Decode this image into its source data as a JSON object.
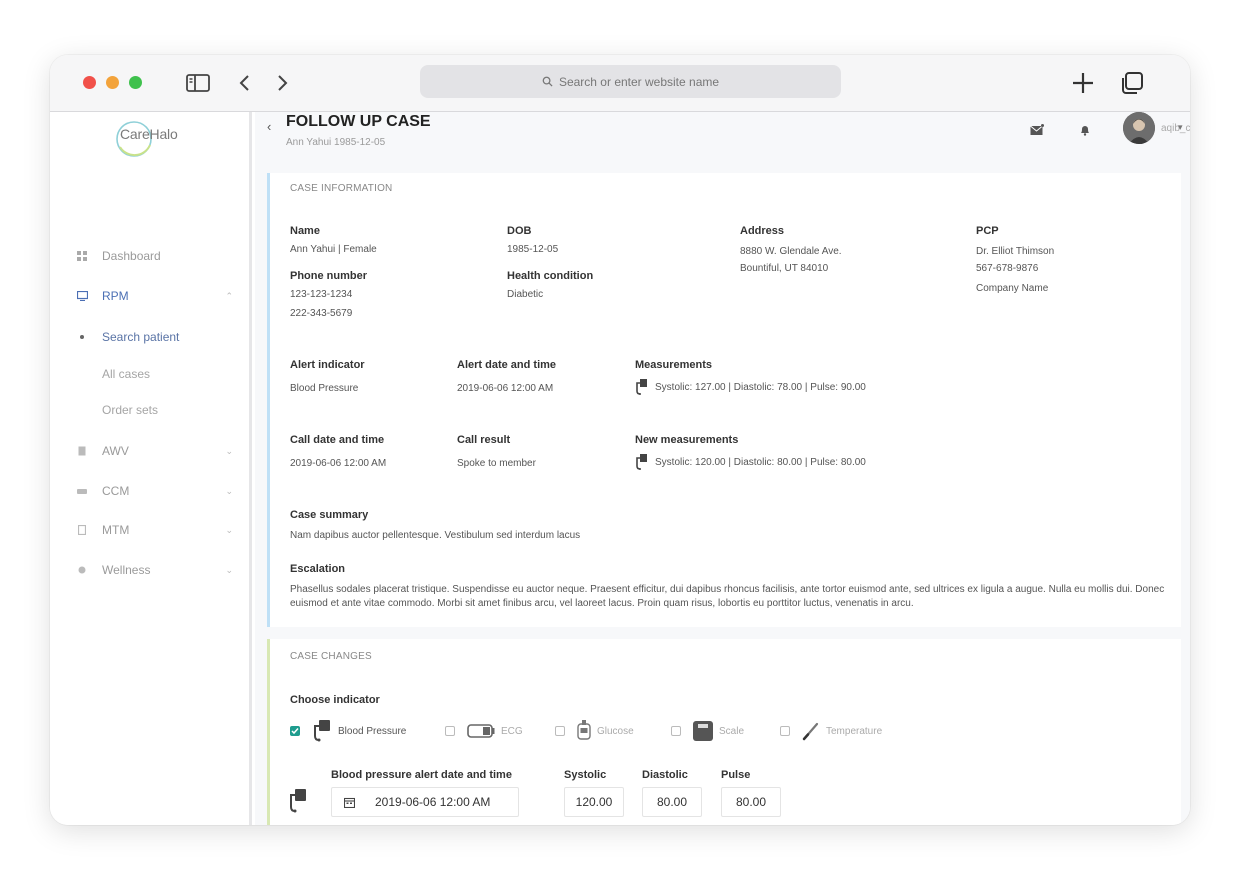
{
  "browser": {
    "url_placeholder": "Search or enter website name"
  },
  "sidebar": {
    "logo": "CareHalo",
    "items": [
      {
        "label": "Dashboard"
      },
      {
        "label": "RPM"
      },
      {
        "label": "AWV"
      },
      {
        "label": "CCM"
      },
      {
        "label": "MTM"
      },
      {
        "label": "Wellness"
      }
    ],
    "rpm_sub": [
      {
        "label": "Search patient"
      },
      {
        "label": "All cases"
      },
      {
        "label": "Order sets"
      }
    ]
  },
  "header": {
    "title": "FOLLOW UP CASE",
    "subtitle": "Ann Yahui  1985-12-05",
    "username": "aqib_care"
  },
  "case_info": {
    "title": "CASE INFORMATION",
    "name_label": "Name",
    "name_value": "Ann Yahui | Female",
    "dob_label": "DOB",
    "dob_value": "1985-12-05",
    "address_label": "Address",
    "address_line1": "8880 W. Glendale Ave.",
    "address_line2": "Bountiful, UT 84010",
    "pcp_label": "PCP",
    "pcp_name": "Dr. Elliot Thimson",
    "pcp_phone": "567-678-9876",
    "pcp_company": "Company Name",
    "phone_label": "Phone number",
    "phone1": "123-123-1234",
    "phone2": "222-343-5679",
    "health_label": "Health condition",
    "health_value": "Diabetic",
    "alert_indicator_label": "Alert indicator",
    "alert_indicator_value": "Blood Pressure",
    "alert_dt_label": "Alert date and time",
    "alert_dt_value": "2019-06-06 12:00 AM",
    "measurements_label": "Measurements",
    "measurements_value": "Systolic: 127.00  |  Diastolic: 78.00  |  Pulse: 90.00",
    "call_dt_label": "Call date and time",
    "call_dt_value": "2019-06-06 12:00 AM",
    "call_result_label": "Call result",
    "call_result_value": "Spoke to member",
    "new_meas_label": "New measurements",
    "new_meas_value": "Systolic: 120.00  |  Diastolic: 80.00  |  Pulse: 80.00",
    "summary_label": "Case summary",
    "summary_value": "Nam dapibus auctor pellentesque. Vestibulum sed interdum lacus",
    "escalation_label": "Escalation",
    "escalation_value": "Phasellus sodales placerat tristique. Suspendisse eu auctor neque. Praesent efficitur, dui dapibus rhoncus facilisis, ante tortor euismod ante, sed ultrices ex ligula a augue. Nulla eu mollis dui. Donec euismod et ante vitae commodo. Morbi sit amet finibus arcu, vel laoreet lacus. Proin quam risus, lobortis eu porttitor luctus, venenatis in arcu."
  },
  "case_changes": {
    "title": "CASE CHANGES",
    "choose_label": "Choose indicator",
    "indicators": [
      {
        "label": "Blood Pressure",
        "checked": true
      },
      {
        "label": "ECG",
        "checked": false
      },
      {
        "label": "Glucose",
        "checked": false
      },
      {
        "label": "Scale",
        "checked": false
      },
      {
        "label": "Temperature",
        "checked": false
      }
    ],
    "bp_dt_label": "Blood pressure alert date and time",
    "bp_dt_value": "2019-06-06 12:00 AM",
    "systolic_label": "Systolic",
    "systolic_value": "120.00",
    "diastolic_label": "Diastolic",
    "diastolic_value": "80.00",
    "pulse_label": "Pulse",
    "pulse_value": "80.00"
  },
  "colors": {
    "accent_blue": "#4b6fb4",
    "check_teal": "#1f9c8e",
    "info_border": "#bfe0f6",
    "changes_border": "#d8e8b4"
  }
}
